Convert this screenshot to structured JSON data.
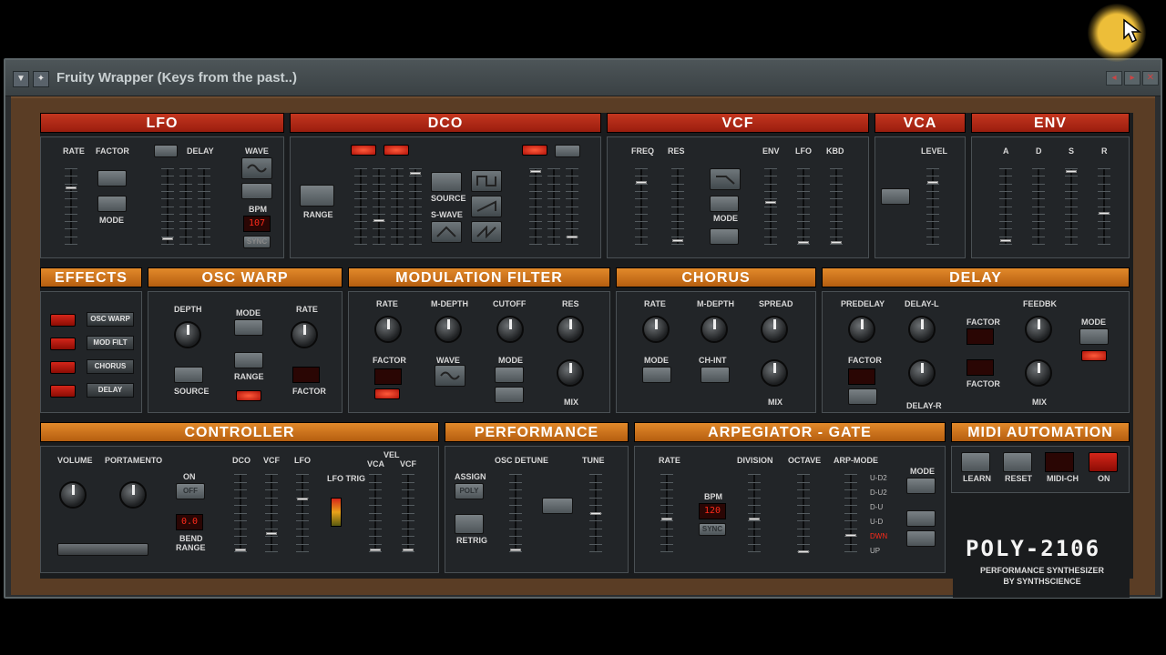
{
  "window": {
    "title": "Fruity Wrapper (Keys from the past..)"
  },
  "colors": {
    "header_red": "#b02a16",
    "header_orange": "#d07a1f",
    "led_red": "#e0281a",
    "panel_wood": "#5a3d25"
  },
  "sections": {
    "lfo": "LFO",
    "dco": "DCO",
    "vcf": "VCF",
    "vca": "VCA",
    "env": "ENV",
    "effects": "EFFECTS",
    "osc_warp": "OSC WARP",
    "mod_filter": "MODULATION FILTER",
    "chorus": "CHORUS",
    "delay": "DELAY",
    "controller": "CONTROLLER",
    "performance": "PERFORMANCE",
    "arp": "ARPEGIATOR - GATE",
    "midi": "MIDI AUTOMATION"
  },
  "lfo": {
    "rate": "RATE",
    "factor": "FACTOR",
    "delay": "DELAY",
    "wave": "WAVE",
    "mode": "MODE",
    "bpm": "BPM",
    "bpm_value": "107",
    "sync": "SYNC"
  },
  "dco": {
    "range": "RANGE",
    "source": "SOURCE",
    "s_wave": "S-WAVE"
  },
  "vcf": {
    "freq": "FREQ",
    "res": "RES",
    "env": "ENV",
    "lfo": "LFO",
    "kbd": "KBD",
    "mode": "MODE"
  },
  "vca": {
    "level": "LEVEL"
  },
  "env": {
    "a": "A",
    "d": "D",
    "s": "S",
    "r": "R"
  },
  "effects": {
    "items": [
      "OSC WARP",
      "MOD FILT",
      "CHORUS",
      "DELAY"
    ]
  },
  "osc_warp": {
    "depth": "DEPTH",
    "mode": "MODE",
    "rate": "RATE",
    "source": "SOURCE",
    "range": "RANGE",
    "factor": "FACTOR"
  },
  "mod_filter": {
    "rate": "RATE",
    "m_depth": "M-DEPTH",
    "cutoff": "CUTOFF",
    "res": "RES",
    "factor": "FACTOR",
    "wave": "WAVE",
    "mode": "MODE",
    "mix": "MIX"
  },
  "chorus": {
    "rate": "RATE",
    "m_depth": "M-DEPTH",
    "spread": "SPREAD",
    "mode": "MODE",
    "ch_int": "CH-INT",
    "mix": "MIX"
  },
  "delay": {
    "predelay": "PREDELAY",
    "delay_l": "DELAY-L",
    "feedbk": "FEEDBK",
    "factor": "FACTOR",
    "mode": "MODE",
    "delay_r": "DELAY-R",
    "mix": "MIX"
  },
  "controller": {
    "volume": "VOLUME",
    "portamento": "PORTAMENTO",
    "on": "ON",
    "off": "OFF",
    "bend_value": "0.0",
    "bend": "BEND",
    "range": "RANGE",
    "dco": "DCO",
    "vcf": "VCF",
    "lfo": "LFO",
    "lfo_trig": "LFO TRIG",
    "vel": "VEL",
    "vca": "VCA",
    "vcf2": "VCF"
  },
  "performance": {
    "osc_detune": "OSC DETUNE",
    "tune": "TUNE",
    "assign": "ASSIGN",
    "poly": "POLY",
    "retrig": "RETRIG"
  },
  "arp": {
    "rate": "RATE",
    "division": "DIVISION",
    "octave": "OCTAVE",
    "arp_mode": "ARP-MODE",
    "bpm": "BPM",
    "bpm_value": "120",
    "sync": "SYNC",
    "mode": "MODE",
    "modes": [
      "U-D2",
      "D-U2",
      "D-U",
      "U-D",
      "DWN",
      "UP"
    ]
  },
  "midi": {
    "buttons": [
      "LEARN",
      "RESET",
      "MIDI-CH",
      "ON"
    ]
  },
  "logo": {
    "title": "POLY-2106",
    "subtitle": "PERFORMANCE SYNTHESIZER",
    "by": "BY SYNTHSCIENCE"
  }
}
